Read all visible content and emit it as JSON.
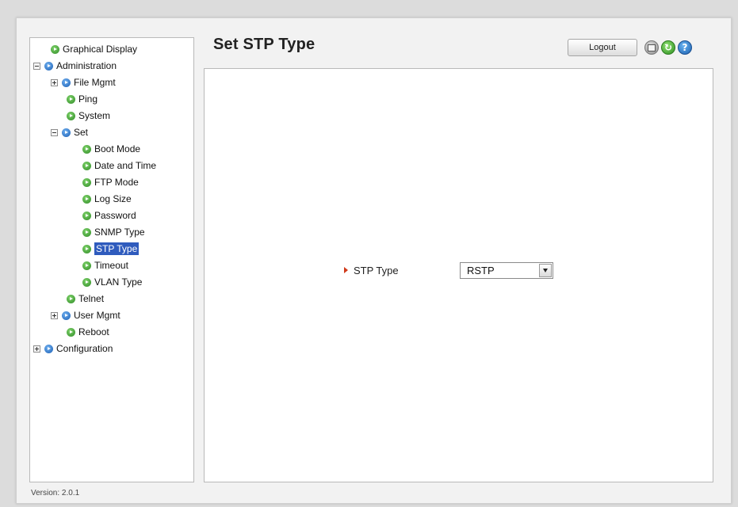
{
  "page": {
    "title": "Set STP Type"
  },
  "toolbar": {
    "logout_label": "Logout",
    "save_icon": "save-icon",
    "refresh_icon": "refresh-icon",
    "help_icon": "help-icon"
  },
  "tree": {
    "items": [
      {
        "label": "Graphical Display",
        "bullet": "green",
        "expander": "none"
      },
      {
        "label": "Administration",
        "bullet": "blue",
        "expander": "minus"
      },
      {
        "label": "File Mgmt",
        "bullet": "blue",
        "expander": "plus"
      },
      {
        "label": "Ping",
        "bullet": "green",
        "expander": "none"
      },
      {
        "label": "System",
        "bullet": "green",
        "expander": "none"
      },
      {
        "label": "Set",
        "bullet": "blue",
        "expander": "minus"
      },
      {
        "label": "Boot Mode",
        "bullet": "green",
        "expander": "none"
      },
      {
        "label": "Date and Time",
        "bullet": "green",
        "expander": "none"
      },
      {
        "label": "FTP Mode",
        "bullet": "green",
        "expander": "none"
      },
      {
        "label": "Log Size",
        "bullet": "green",
        "expander": "none"
      },
      {
        "label": "Password",
        "bullet": "green",
        "expander": "none"
      },
      {
        "label": "SNMP Type",
        "bullet": "green",
        "expander": "none"
      },
      {
        "label": "STP Type",
        "bullet": "green",
        "expander": "none",
        "selected": true
      },
      {
        "label": "Timeout",
        "bullet": "green",
        "expander": "none"
      },
      {
        "label": "VLAN Type",
        "bullet": "green",
        "expander": "none"
      },
      {
        "label": "Telnet",
        "bullet": "green",
        "expander": "none"
      },
      {
        "label": "User Mgmt",
        "bullet": "blue",
        "expander": "plus"
      },
      {
        "label": "Reboot",
        "bullet": "green",
        "expander": "none"
      },
      {
        "label": "Configuration",
        "bullet": "blue",
        "expander": "plus"
      }
    ]
  },
  "form": {
    "stp_type_label": "STP Type",
    "stp_type_value": "RSTP"
  },
  "footer": {
    "version": "Version: 2.0.1"
  },
  "colors": {
    "selected_bg": "#2f5bbd",
    "required_arrow": "#d03a1a"
  }
}
